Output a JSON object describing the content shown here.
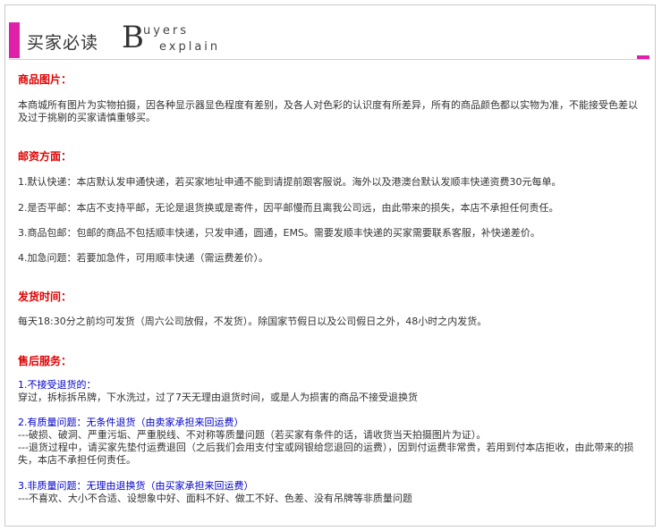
{
  "header": {
    "cn_title": "买家必读",
    "big_letter": "B",
    "en_line1": "uyers",
    "en_line2": "explain"
  },
  "sections": {
    "images": {
      "title": "商品图片：",
      "text": "本商城所有图片为实物拍摄，因各种显示器显色程度有差别，及各人对色彩的认识度有所差异，所有的商品颜色都以实物为准，不能接受色差以及过于挑剔的买家请慎重够买。"
    },
    "postage": {
      "title": "邮资方面：",
      "items": [
        "1.默认快递：本店默认发申通快递，若买家地址申通不能到请提前跟客服说。海外以及港澳台默认发顺丰快递资费30元每单。",
        "2.是否平邮：本店不支持平邮，无论是退货换或是寄件，因平邮慢而且离我公司远，由此带来的损失，本店不承担任何责任。",
        "3.商品包邮：包邮的商品不包括顺丰快递，只发申通，圆通，EMS。需要发顺丰快递的买家需要联系客服，补快递差价。",
        "4.加急问题：若要加急件，可用顺丰快递（需运费差价）。"
      ]
    },
    "shipping": {
      "title": "发货时间：",
      "text": "每天18:30分之前均可发货（周六公司放假，不发货）。除国家节假日以及公司假日之外，48小时之内发货。"
    },
    "aftersale": {
      "title": "售后服务：",
      "i1_title": "1.不接受退货的：",
      "i1_text": "穿过，拆标拆吊牌，下水洗过，过了7天无理由退货时间，或是人为损害的商品不接受退换货",
      "i2_title": "2.有质量问题：无条件退货（由卖家承担来回运费）",
      "i2_line1": "---破损、破洞、严重污垢、严重脱线、不对称等质量问题（若买家有条件的话，请收货当天拍摄图片为证）。",
      "i2_line2": "---退货过程中，请买家先垫付运费退回（之后我们会用支付宝或网银给您退回的运费），因到付运费非常贵，若用到付本店拒收，由此带来的损失，本店不承担任何责任。",
      "i3_title": "3.非质量问题：无理由退换货（由买家承担来回运费）",
      "i3_line1": "---不喜欢、大小不合适、设想象中好、面料不好、做工不好、色差、没有吊牌等非质量问题"
    }
  }
}
